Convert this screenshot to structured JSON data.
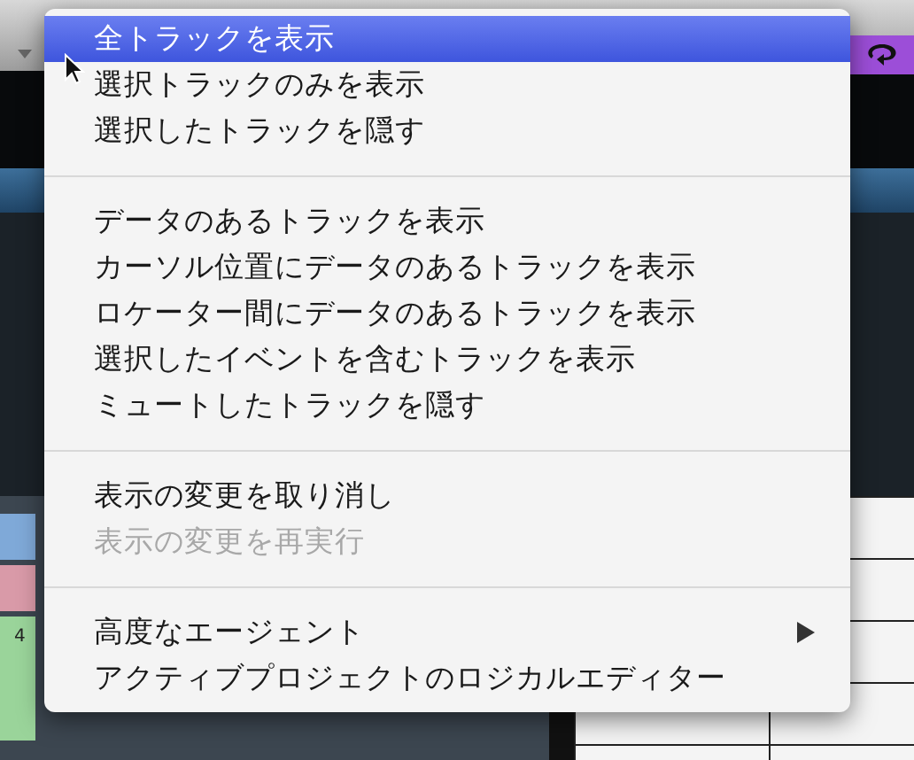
{
  "track_list": {
    "track_number": "4"
  },
  "menu": {
    "items": [
      {
        "kind": "item",
        "label": "全トラックを表示",
        "selected": true,
        "disabled": false,
        "submenu": false
      },
      {
        "kind": "item",
        "label": "選択トラックのみを表示",
        "selected": false,
        "disabled": false,
        "submenu": false
      },
      {
        "kind": "item",
        "label": "選択したトラックを隠す",
        "selected": false,
        "disabled": false,
        "submenu": false
      },
      {
        "kind": "separator"
      },
      {
        "kind": "item",
        "label": "データのあるトラックを表示",
        "selected": false,
        "disabled": false,
        "submenu": false
      },
      {
        "kind": "item",
        "label": "カーソル位置にデータのあるトラックを表示",
        "selected": false,
        "disabled": false,
        "submenu": false
      },
      {
        "kind": "item",
        "label": "ロケーター間にデータのあるトラックを表示",
        "selected": false,
        "disabled": false,
        "submenu": false
      },
      {
        "kind": "item",
        "label": "選択したイベントを含むトラックを表示",
        "selected": false,
        "disabled": false,
        "submenu": false
      },
      {
        "kind": "item",
        "label": "ミュートしたトラックを隠す",
        "selected": false,
        "disabled": false,
        "submenu": false
      },
      {
        "kind": "separator"
      },
      {
        "kind": "item",
        "label": "表示の変更を取り消し",
        "selected": false,
        "disabled": false,
        "submenu": false
      },
      {
        "kind": "item",
        "label": "表示の変更を再実行",
        "selected": false,
        "disabled": true,
        "submenu": false
      },
      {
        "kind": "separator"
      },
      {
        "kind": "item",
        "label": "高度なエージェント",
        "selected": false,
        "disabled": false,
        "submenu": true
      },
      {
        "kind": "item",
        "label": "アクティブプロジェクトのロジカルエディター",
        "selected": false,
        "disabled": false,
        "submenu": false
      }
    ]
  }
}
